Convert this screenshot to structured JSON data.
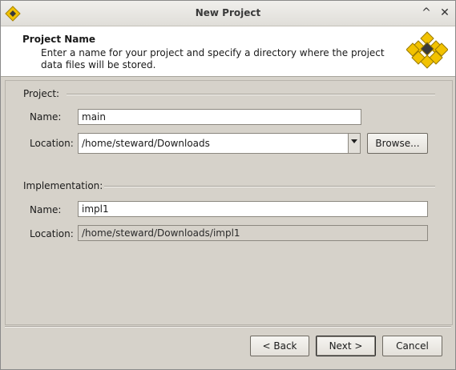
{
  "window": {
    "title": "New Project",
    "minimize_glyph": "^",
    "close_glyph": "✕"
  },
  "header": {
    "title": "Project Name",
    "description": "Enter a name for your project and specify a directory where the project data files will be stored."
  },
  "project": {
    "group_label": "Project:",
    "name_label": "Name:",
    "name_value": "main",
    "location_label": "Location:",
    "location_value": "/home/steward/Downloads",
    "browse_label": "Browse..."
  },
  "implementation": {
    "group_label": "Implementation:",
    "name_label": "Name:",
    "name_value": "impl1",
    "location_label": "Location:",
    "location_value": "/home/steward/Downloads/impl1"
  },
  "buttons": {
    "back": "< Back",
    "next": "Next >",
    "cancel": "Cancel"
  },
  "colors": {
    "logo_gold": "#f2c200",
    "logo_dark": "#3a3a3a",
    "header_bg": "#ffffff",
    "dialog_bg": "#d6d2ca"
  },
  "icons": {
    "app_logo": "diamond-logo-icon",
    "header_logo": "diamond-cluster-logo-icon"
  }
}
